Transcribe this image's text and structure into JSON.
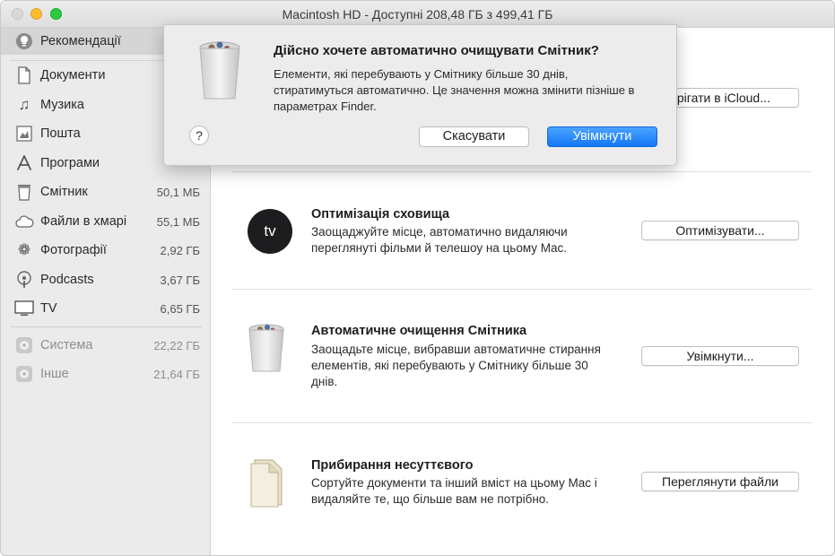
{
  "window": {
    "title": "Macintosh HD - Доступні 208,48 ГБ з 499,41 ГБ"
  },
  "sidebar": {
    "items": [
      {
        "label": "Рекомендації",
        "size": "",
        "icon": "lightbulb-icon"
      },
      {
        "label": "Документи",
        "size": "",
        "icon": "document-icon"
      },
      {
        "label": "Музика",
        "size": "",
        "icon": "music-note-icon"
      },
      {
        "label": "Пошта",
        "size": "",
        "icon": "mail-stamp-icon"
      },
      {
        "label": "Програми",
        "size": "",
        "icon": "apps-icon"
      },
      {
        "label": "Смітник",
        "size": "50,1 МБ",
        "icon": "trash-icon"
      },
      {
        "label": "Файли в хмарі",
        "size": "55,1 МБ",
        "icon": "cloud-icon"
      },
      {
        "label": "Фотографії",
        "size": "2,92 ГБ",
        "icon": "photos-flower-icon"
      },
      {
        "label": "Podcasts",
        "size": "3,67 ГБ",
        "icon": "podcast-icon"
      },
      {
        "label": "TV",
        "size": "6,65 ГБ",
        "icon": "tv-icon"
      },
      {
        "label": "Система",
        "size": "22,22 ГБ",
        "icon": "system-disk-icon"
      },
      {
        "label": "Інше",
        "size": "21,64 ГБ",
        "icon": "other-disk-icon"
      }
    ]
  },
  "main": {
    "rows": [
      {
        "title": "",
        "description": "",
        "button": "ерігати в iCloud..."
      },
      {
        "title": "Оптимізація сховища",
        "description": "Заощаджуйте місце, автоматично видаляючи переглянуті фільми й телешоу на цьому Mac.",
        "button": "Оптимізувати...",
        "icon": "apple-tv-icon",
        "icon_text": "tv"
      },
      {
        "title": "Автоматичне очищення Смітника",
        "description": "Заощадьте місце, вибравши автоматичне стирання елементів, які перебувають у Смітнику більше 30 днів.",
        "button": "Увімкнути...",
        "icon": "trash-can-icon"
      },
      {
        "title": "Прибирання несуттєвого",
        "description": "Сортуйте документи та інший вміст на цьому Mac і видаляйте те, що більше вам не потрібно.",
        "button": "Переглянути файли",
        "icon": "documents-icon"
      }
    ]
  },
  "dialog": {
    "title": "Дійсно хочете автоматично очищувати Смітник?",
    "text": "Елементи, які перебувають у Смітнику більше 30 днів, стиратимуться автоматично. Це значення можна змінити пізніше в параметрах Finder.",
    "help_label": "?",
    "cancel_label": "Скасувати",
    "ok_label": "Увімкнути"
  },
  "colors": {
    "accent": "#1477f5",
    "sidebar_bg": "#ebebeb",
    "selected_bg": "#d5d5d5"
  }
}
